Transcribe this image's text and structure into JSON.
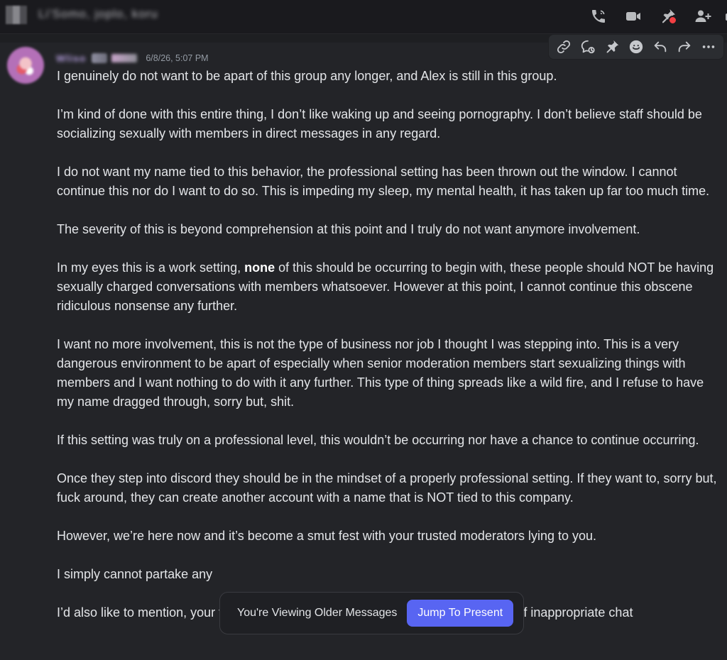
{
  "header": {
    "title": "Li'Somo, joplo, koru",
    "icons": [
      "phone-call-icon",
      "video-camera-icon",
      "pin-icon",
      "add-member-icon"
    ]
  },
  "message": {
    "username": "Wliso",
    "timestamp": "6/8/26, 5:07 PM",
    "toolbar_icons": [
      "link-icon",
      "thread-icon",
      "pin-icon",
      "add-reaction-icon",
      "reply-icon",
      "forward-icon",
      "more-icon"
    ],
    "paragraphs": [
      "I genuinely do not want to be apart of this group any longer, and Alex is still in this group.",
      "I’m kind of done with this entire thing, I don’t like waking up and seeing pornography. I don’t believe staff should be socializing sexually with members in direct messages in any regard.",
      "I do not want my name tied to this behavior, the professional setting has been thrown out the window. I cannot continue this nor do I want to do so. This is impeding my sleep, my mental health, it has taken up far too much time.",
      "The severity of this is beyond comprehension at this point and I truly do not want anymore involvement."
    ],
    "p5": {
      "before": "In my eyes this is a work setting, ",
      "bold": "none",
      "after": " of this should be occurring to begin with, these people should NOT be having sexually charged conversations with members whatsoever. However at this point, I cannot continue this obscene ridiculous nonsense any further."
    },
    "paragraphs_b": [
      "I want no more involvement, this is not the type of business nor job I thought I was stepping into. This is a very dangerous environment to be apart of especially when senior moderation members start sexualizing things with members and I want nothing to do with it any further. This type of thing spreads like a wild fire, and I refuse to have my name dragged through, sorry but, shit.",
      "If this setting was truly on a professional level, this wouldn’t be occurring nor have a chance to continue occurring.",
      "Once they step into discord they should be in the mindset of a properly professional setting. If they want to, sorry but, fuck around, they can create another account with a name that is NOT tied to this company.",
      "However, we’re here now and it’s become a smut fest with your trusted moderators lying to you.",
      "I simply cannot partake any",
      "I’d also like to mention, your ticket system is backed up, and there has been a lot of inappropriate chat"
    ]
  },
  "older_messages": {
    "label": "You're Viewing Older Messages",
    "button": "Jump To Present"
  },
  "colors": {
    "accent": "#5865f2",
    "background": "#1e1f22",
    "notification_dot": "#f23f43"
  }
}
